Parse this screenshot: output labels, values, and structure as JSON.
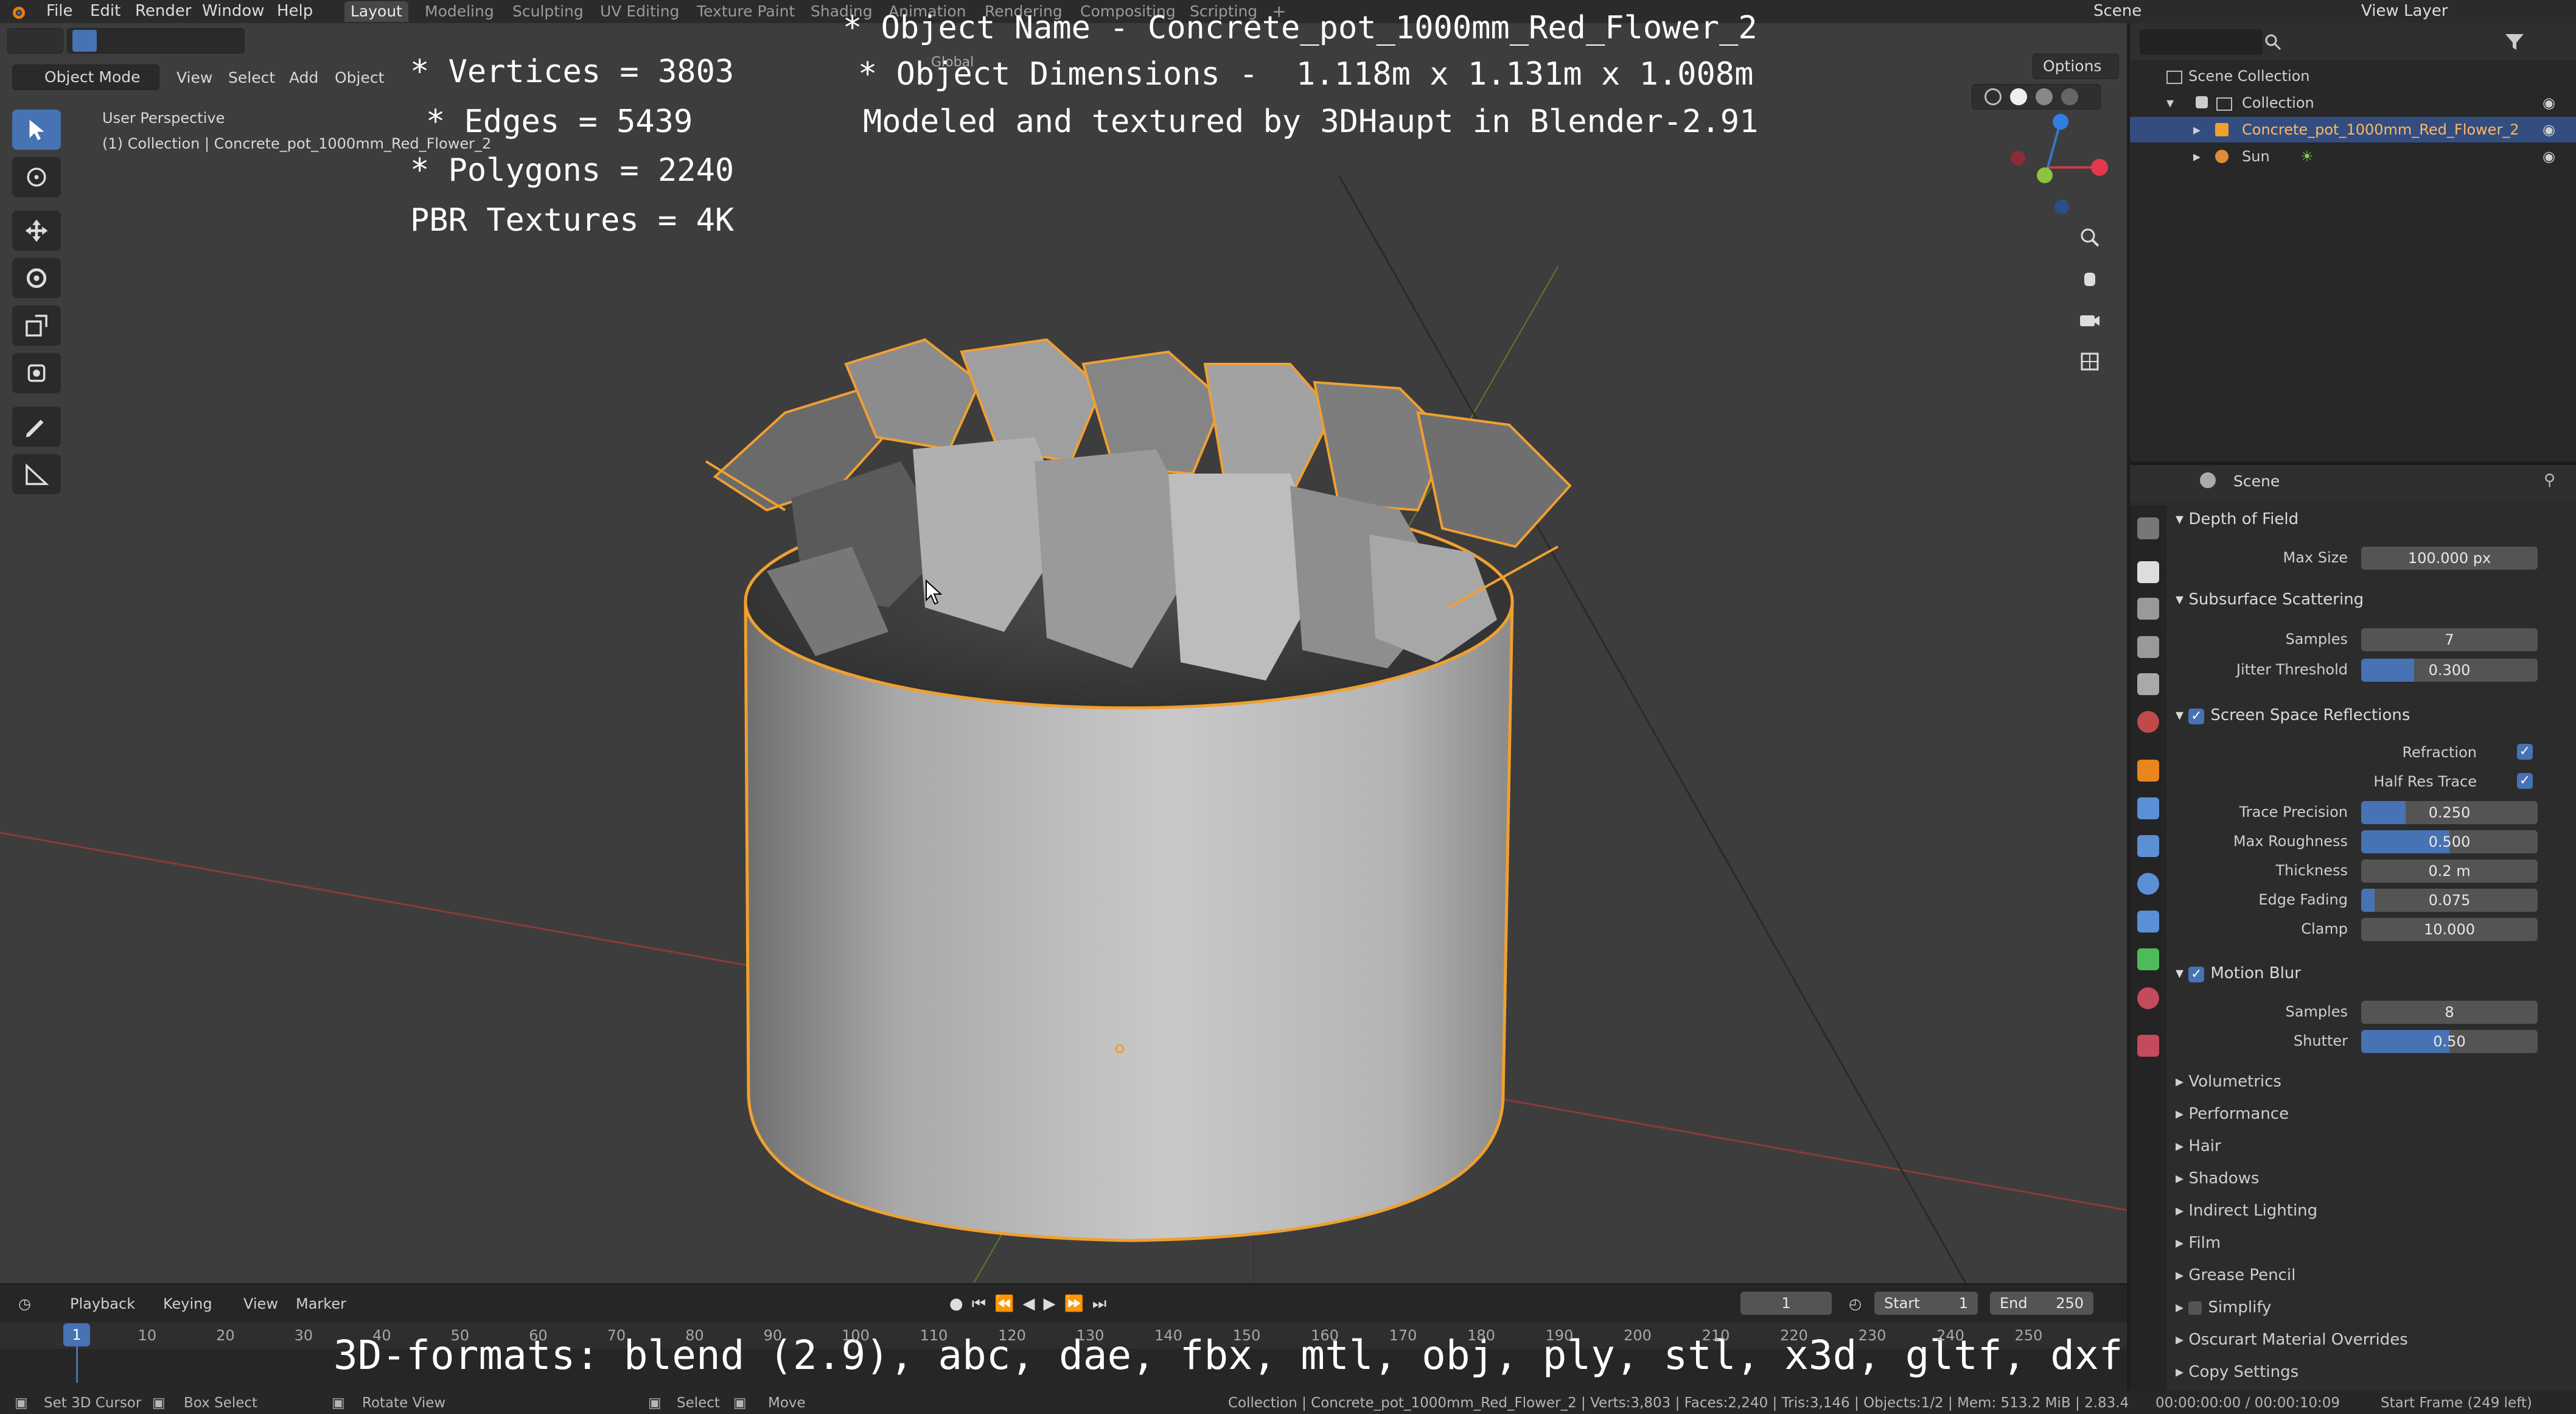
{
  "topbar": {
    "menus": [
      "File",
      "Edit",
      "Render",
      "Window",
      "Help"
    ],
    "workspaces": [
      "Layout",
      "Modeling",
      "Sculpting",
      "UV Editing",
      "Texture Paint",
      "Shading",
      "Animation",
      "Rendering",
      "Compositing",
      "Scripting"
    ],
    "active_workspace": "Layout",
    "scene": "Scene",
    "view_layer": "View Layer"
  },
  "viewport": {
    "mode": "Object Mode",
    "menus": [
      "View",
      "Select",
      "Add",
      "Object"
    ],
    "orientation": "Global",
    "options": "Options",
    "perspective_label": "User Perspective",
    "collection_label": "(1) Collection | Concrete_pot_1000mm_Red_Flower_2"
  },
  "overlay": {
    "vertices": "* Vertices = 3803",
    "edges": "* Edges = 5439",
    "polygons": "* Polygons = 2240",
    "textures": "PBR Textures = 4K",
    "object_name": "* Object Name - Concrete_pot_1000mm_Red_Flower_2",
    "object_dims": "* Object Dimensions -  1.118m x 1.131m x 1.008m",
    "credit": "Modeled and textured by 3DHaupt in Blender-2.91",
    "formats": "3D-formats: blend (2.9), abc, dae, fbx, mtl, obj, ply, stl, x3d, gltf, dxf"
  },
  "outliner": {
    "root": "Scene Collection",
    "collection": "Collection",
    "object": "Concrete_pot_1000mm_Red_Flower_2",
    "light": "Sun"
  },
  "properties": {
    "context": "Scene",
    "dof": {
      "title": "Depth of Field",
      "max_size_label": "Max Size",
      "max_size": "100.000 px"
    },
    "sss": {
      "title": "Subsurface Scattering",
      "samples_label": "Samples",
      "samples": "7",
      "jitter_label": "Jitter Threshold",
      "jitter": "0.300",
      "jitter_fill": 0.3
    },
    "ssr": {
      "title": "Screen Space Reflections",
      "refraction_label": "Refraction",
      "half_res_label": "Half Res Trace",
      "trace_label": "Trace Precision",
      "trace": "0.250",
      "trace_fill": 0.25,
      "rough_label": "Max Roughness",
      "rough": "0.500",
      "rough_fill": 0.5,
      "thick_label": "Thickness",
      "thick": "0.2 m",
      "fade_label": "Edge Fading",
      "fade": "0.075",
      "fade_fill": 0.075,
      "clamp_label": "Clamp",
      "clamp": "10.000"
    },
    "motion_blur": {
      "title": "Motion Blur",
      "samples_label": "Samples",
      "samples": "8",
      "shutter_label": "Shutter",
      "shutter": "0.50",
      "shutter_fill": 0.5
    },
    "collapsed": [
      "Volumetrics",
      "Performance",
      "Hair",
      "Shadows",
      "Indirect Lighting",
      "Film",
      "Grease Pencil",
      "Simplify",
      "Oscurart Material Overrides",
      "Copy Settings"
    ]
  },
  "timeline": {
    "menus": [
      "Playback",
      "Keying",
      "View",
      "Marker"
    ],
    "current_frame": "1",
    "start_label": "Start",
    "start": "1",
    "end_label": "End",
    "end": "250",
    "ruler": [
      "1",
      "10",
      "20",
      "30",
      "40",
      "50",
      "60",
      "70",
      "80",
      "90",
      "100",
      "110",
      "120",
      "130",
      "140",
      "150",
      "160",
      "170",
      "180",
      "190",
      "200",
      "210",
      "220",
      "230",
      "240",
      "250"
    ]
  },
  "status": {
    "cursor": "Set 3D Cursor",
    "box": "Box Select",
    "rotate": "Rotate View",
    "select": "Select",
    "move": "Move",
    "stats": "Collection | Concrete_pot_1000mm_Red_Flower_2 | Verts:3,803 | Faces:2,240 | Tris:3,146 | Objects:1/2 | Mem: 513.2 MiB | 2.83.4",
    "time": "00:00:00:00 / 00:00:10:09",
    "start_frame": "Start Frame (249 left)"
  },
  "colors": {
    "accent": "#4772b3",
    "selection_outline": "#f0a030",
    "viewport_bg": "#3d3d3d"
  }
}
